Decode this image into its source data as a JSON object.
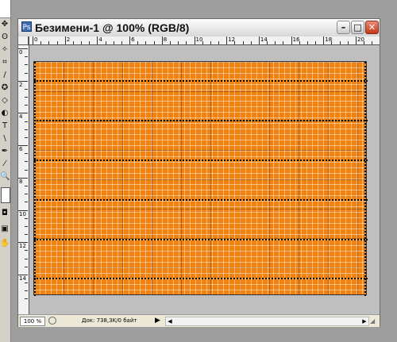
{
  "tools": {
    "items": [
      "move-tool",
      "lasso-tool",
      "magic-wand-tool",
      "crop-tool",
      "brush-tool",
      "stamp-tool",
      "eraser-tool",
      "gradient-tool",
      "burn-tool",
      "type-tool",
      "line-tool",
      "pen-tool",
      "eyedropper-tool",
      "zoom-tool"
    ],
    "glyphs": [
      "✥",
      "ʘ",
      "✧",
      "⌗",
      "/",
      "✪",
      "◇",
      "◐",
      "●",
      "T",
      "\\",
      "✒",
      "⁄",
      "🔍"
    ]
  },
  "window": {
    "title": "Безимени-1 @ 100% (RGB/8)",
    "buttons": {
      "minimize": "–",
      "maximize": "□",
      "close": "✕"
    }
  },
  "ruler": {
    "top_labels": [
      "0",
      "2",
      "4",
      "6",
      "8",
      "10",
      "12",
      "14",
      "16",
      "18",
      "20"
    ],
    "left_labels": [
      "0",
      "2",
      "4",
      "6",
      "8",
      "10",
      "12",
      "14"
    ]
  },
  "canvas": {
    "fill_color": "#f2820f",
    "grid_color": "#ffffff",
    "selection_color": "#000000"
  },
  "status": {
    "zoom": "100 %",
    "doc_info": "Док: 738,3K/0 байт"
  }
}
